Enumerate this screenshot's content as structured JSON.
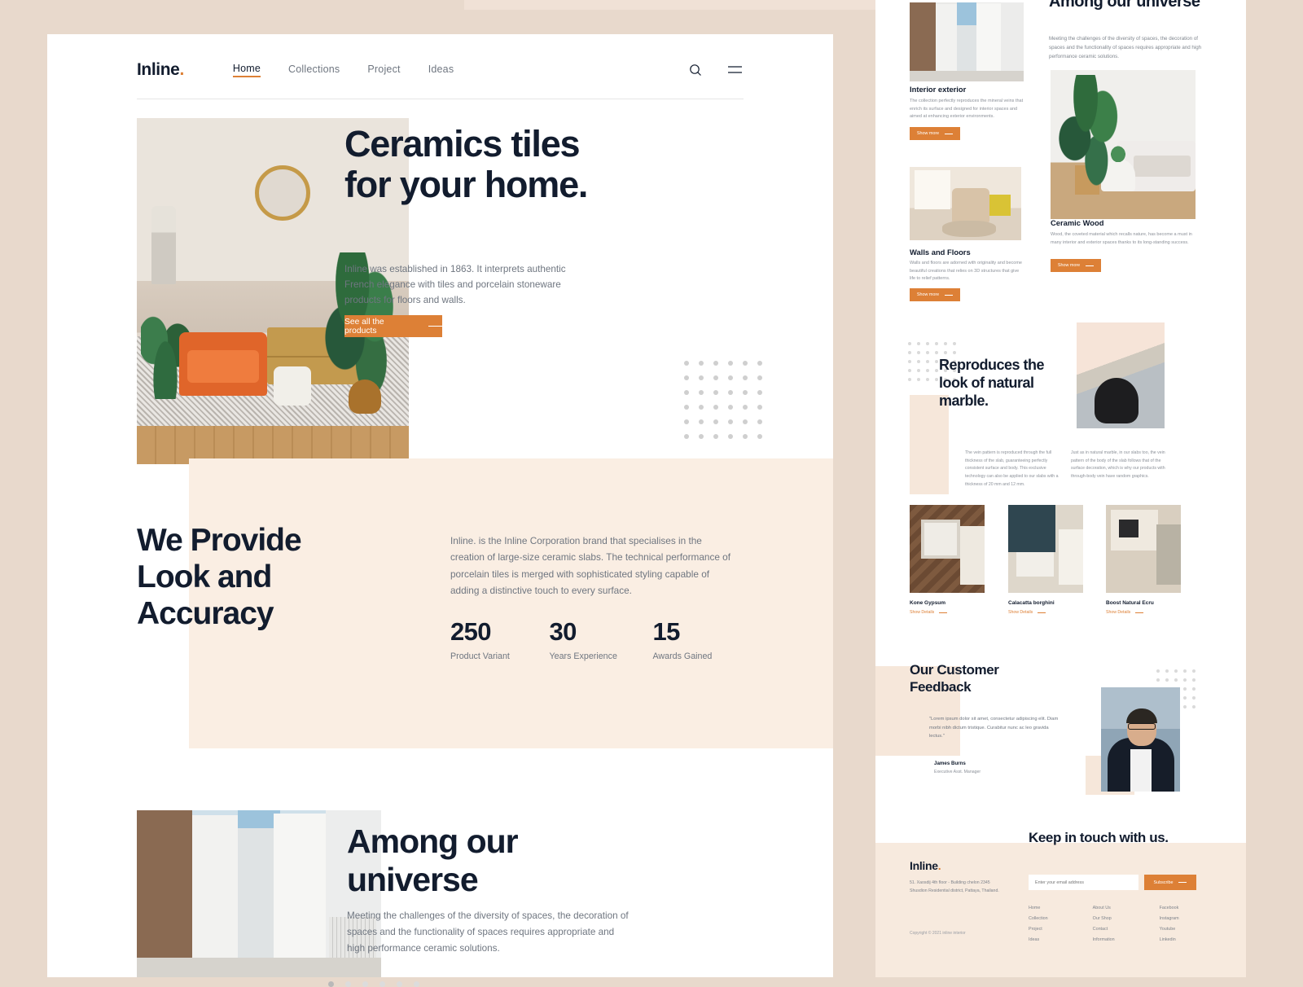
{
  "theme": {
    "accent": "#dd8036",
    "ink": "#121c2e",
    "muted": "#6f7680",
    "beige": "#faeee3",
    "page_bg": "#e8d9cc"
  },
  "left_page": {
    "nav": {
      "logo": "Inline",
      "logo_dot": ".",
      "links": [
        {
          "label": "Home",
          "active": true
        },
        {
          "label": "Collections",
          "active": false
        },
        {
          "label": "Project",
          "active": false
        },
        {
          "label": "Ideas",
          "active": false
        }
      ],
      "search_icon": "search-icon",
      "menu_icon": "hamburger-menu-icon"
    },
    "hero": {
      "title": "Ceramics tiles for your home.",
      "description": "Inline was established in 1863. It interprets authentic French elegance with tiles and porcelain stoneware products for floors and walls.",
      "cta_label": "See all the products",
      "image_alt": "living-room-with-orange-armchair-and-plants"
    },
    "provide": {
      "title": "We Provide Look and Accuracy",
      "description": "Inline. is the Inline Corporation brand that specialises in the creation of large-size ceramic slabs. The technical performance of porcelain tiles is merged with sophisticated styling capable of adding a distinctive touch to every surface.",
      "stats": [
        {
          "value": "250",
          "label": "Product Variant"
        },
        {
          "value": "30",
          "label": "Years Experience"
        },
        {
          "value": "15",
          "label": "Awards Gained"
        }
      ]
    },
    "universe": {
      "title": "Among our universe",
      "description": "Meeting the challenges of the diversity of spaces, the decoration of spaces and the functionality of spaces requires appropriate and high performance ceramic solutions.",
      "image_alt": "narrow-alley-between-modern-buildings",
      "pager_count": 6,
      "pager_active_index": 0
    }
  },
  "right_page": {
    "universe": {
      "title": "Among our universe",
      "description": "Meeting the challenges of the diversity of spaces, the decoration of spaces and the functionality of spaces requires appropriate and high performance ceramic solutions."
    },
    "cards": [
      {
        "title": "Interior exterior",
        "description": "The collection perfectly reproduces the mineral veins that enrich its surface and designed for interior spaces and aimed at enhancing exterior environments.",
        "button": "Show more"
      },
      {
        "title": "Ceramic Wood",
        "description": "Wood, the coveted material which recalls nature, has become a must in many interior and exterior spaces thanks to its long-standing success.",
        "button": "Show more"
      },
      {
        "title": "Walls and Floors",
        "description": "Walls and floors are adorned with originality and become beautiful creations that relies on 3D structures that give life to relief patterns.",
        "button": "Show more"
      }
    ],
    "marble": {
      "title": "Reproduces the look of natural marble.",
      "paragraph_1": "The vein pattern is reproduced through the full thickness of the slab, guaranteeing perfectly consistent surface and body. This exclusive technology can also be applied to our slabs with a thickness of 20 mm and 12 mm.",
      "paragraph_2": "Just as in natural marble, in our slabs too, the vein pattern of the body of the slab follows that of the surface decoration, which is why our products with through-body vein have random graphics."
    },
    "products": [
      {
        "name": "Kone Gypsum",
        "link": "Show Details"
      },
      {
        "name": "Calacatta borghini",
        "link": "Show Details"
      },
      {
        "name": "Boost Natural Ecru",
        "link": "Show Details"
      }
    ],
    "feedback": {
      "title": "Our Customer Feedback",
      "quote": "\"Lorem ipsum dolor sit amet, consectetur adipiscing elit. Diam morbi nibh dictum tristique. Curabitur nunc ac leo gravida lectus.\"",
      "name": "James Burns",
      "role": "Executive Asst. Manager"
    },
    "footer": {
      "logo": "Inline",
      "logo_dot": ".",
      "address": "51. Xaosdij 4th floor - Building chelon 2345 Shusdion Residential district, Pattaya, Thailand.",
      "copyright": "Copyright © 2021 inline interior",
      "newsletter_title": "Keep in touch with us.",
      "email_placeholder": "Enter your email address",
      "subscribe_label": "Subscribe",
      "columns": [
        [
          "Home",
          "Collection",
          "Project",
          "Ideas"
        ],
        [
          "About Us",
          "Our Shop",
          "Contact",
          "Information"
        ],
        [
          "Facebook",
          "Instagram",
          "Youtube",
          "Linkedin"
        ]
      ]
    }
  }
}
